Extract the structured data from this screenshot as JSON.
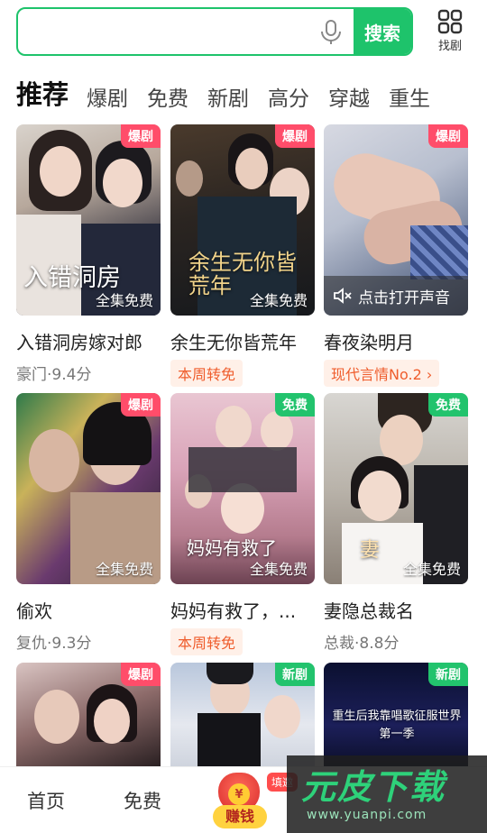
{
  "search": {
    "placeholder": "",
    "button_label": "搜索",
    "find_label": "找剧"
  },
  "tabs": [
    {
      "label": "推荐",
      "active": true
    },
    {
      "label": "爆剧"
    },
    {
      "label": "免费"
    },
    {
      "label": "新剧"
    },
    {
      "label": "高分"
    },
    {
      "label": "穿越"
    },
    {
      "label": "重生"
    }
  ],
  "cards": [
    {
      "title": "入错洞房嫁对郎",
      "badge": "爆剧",
      "overlay": "全集免费",
      "art_title": "入错洞房",
      "sub": "豪门·9.4分"
    },
    {
      "title": "余生无你皆荒年",
      "badge": "爆剧",
      "overlay": "全集免费",
      "art_title": "余生无你皆荒年",
      "tag": "本周转免"
    },
    {
      "title": "春夜染明月",
      "badge": "爆剧",
      "sound": "点击打开声音",
      "tag": "现代言情No.2 ›"
    },
    {
      "title": "偷欢",
      "badge": "爆剧",
      "overlay": "全集免费",
      "sub": "复仇·9.3分"
    },
    {
      "title": "妈妈有救了，...",
      "badge": "免费",
      "overlay": "全集免费",
      "art_title": "妈妈有救了",
      "tag": "本周转免"
    },
    {
      "title": "妻隐总裁名",
      "badge": "免费",
      "overlay": "全集免费",
      "art_title": "妻",
      "sub": "总裁·8.8分"
    },
    {
      "badge": "爆剧"
    },
    {
      "badge": "新剧"
    },
    {
      "badge": "新剧",
      "art_title": "重生后我靠唱歌征服世界 第一季"
    }
  ],
  "bottom_nav": {
    "home": "首页",
    "free": "免费",
    "earn": "赚钱",
    "earn_coin": "¥",
    "invite": "填邀"
  },
  "watermark": {
    "main": "元皮下载",
    "url": "www.yuanpi.com"
  },
  "colors": {
    "accent_green": "#1ec36b",
    "hot_badge": "#ff4d6a",
    "free_badge": "#22c36d",
    "tag_orange": "#ef5d2d"
  }
}
